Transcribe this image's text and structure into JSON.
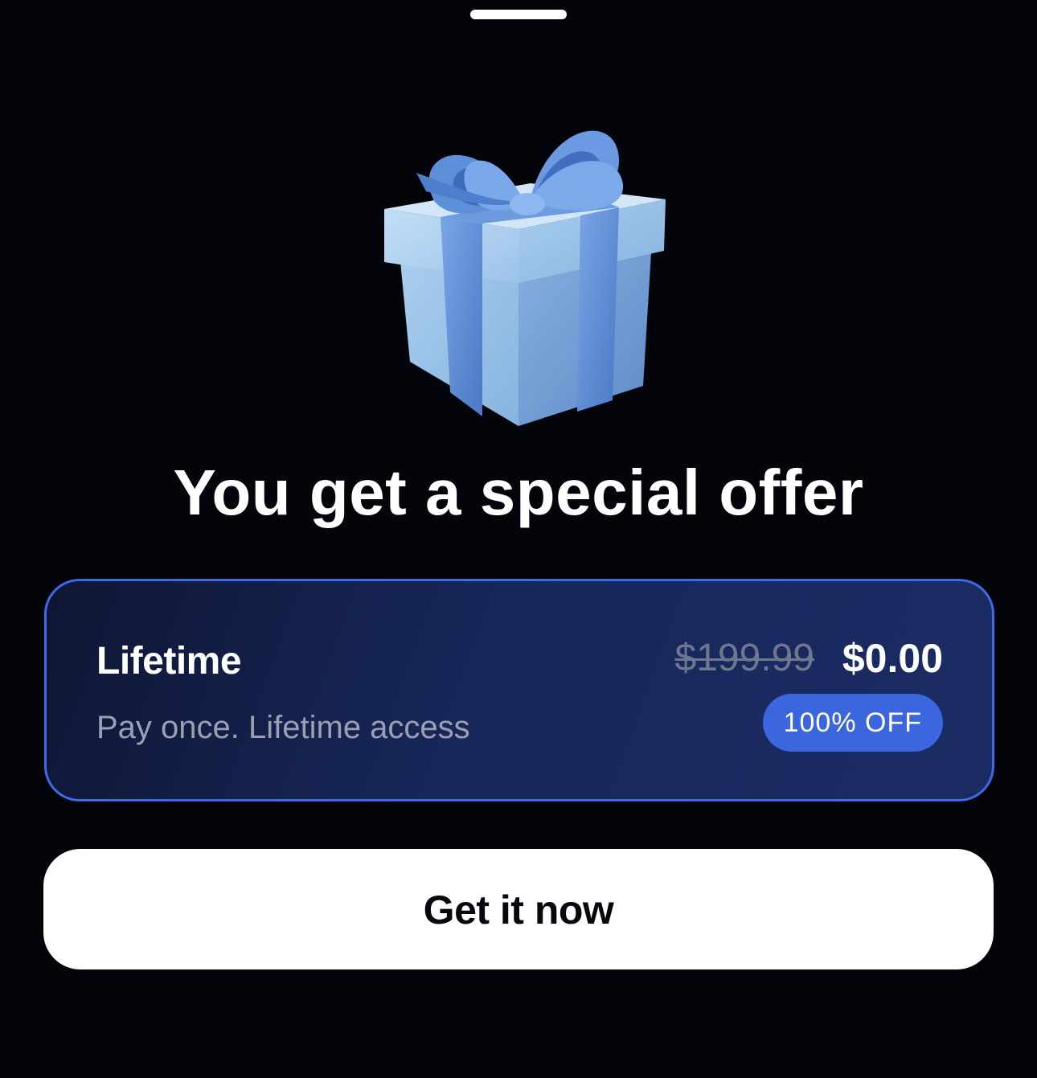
{
  "header": {
    "title": "You get a special offer"
  },
  "plan": {
    "name": "Lifetime",
    "description": "Pay once. Lifetime access",
    "original_price": "$199.99",
    "price": "$0.00",
    "discount_badge": "100% OFF"
  },
  "cta": {
    "label": "Get it now"
  },
  "icons": {
    "hero": "gift-box-icon"
  },
  "colors": {
    "background": "#04050b",
    "accent": "#3d6ae6",
    "badge": "#3c66de",
    "gift_box": "#9cc3e8",
    "gift_ribbon": "#5b8fd6",
    "button": "#ffffff"
  }
}
